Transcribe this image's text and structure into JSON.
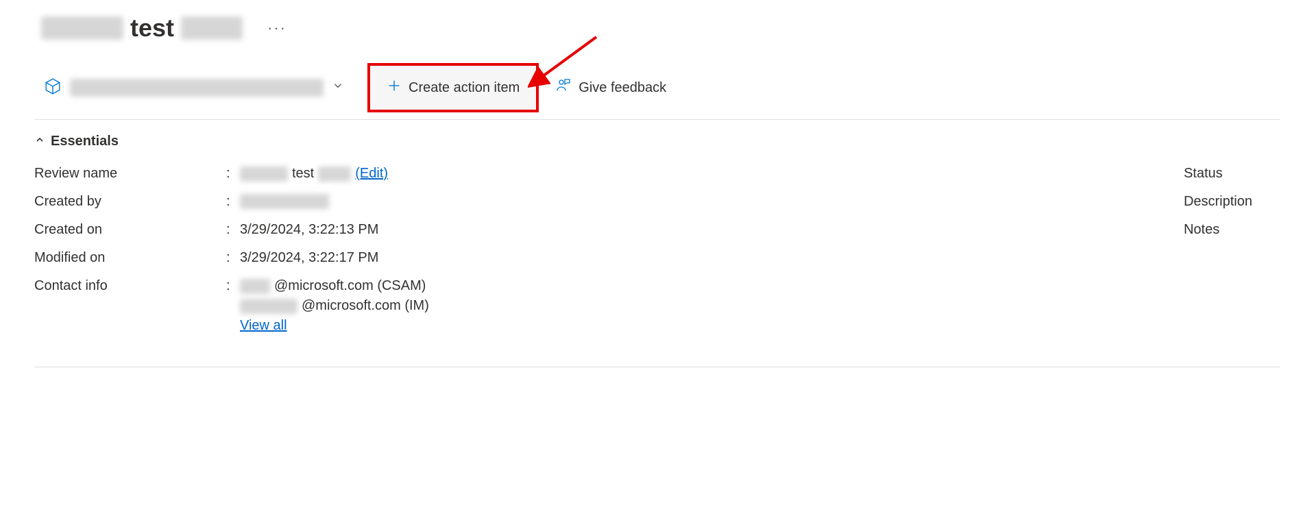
{
  "header": {
    "title_middle": "test",
    "overflow": "···"
  },
  "toolbar": {
    "create_action_label": "Create action item",
    "give_feedback_label": "Give feedback"
  },
  "essentials": {
    "section_label": "Essentials",
    "left": {
      "review_name": {
        "label": "Review name",
        "middle": "test",
        "edit": "(Edit)"
      },
      "created_by": {
        "label": "Created by"
      },
      "created_on": {
        "label": "Created on",
        "value": "3/29/2024, 3:22:13 PM"
      },
      "modified_on": {
        "label": "Modified on",
        "value": "3/29/2024, 3:22:17 PM"
      },
      "contact_info": {
        "label": "Contact info",
        "line1_suffix": "@microsoft.com (CSAM)",
        "line2_suffix": "@microsoft.com (IM)",
        "view_all": "View all"
      }
    },
    "right": {
      "status": "Status",
      "description": "Description",
      "notes": "Notes"
    }
  }
}
